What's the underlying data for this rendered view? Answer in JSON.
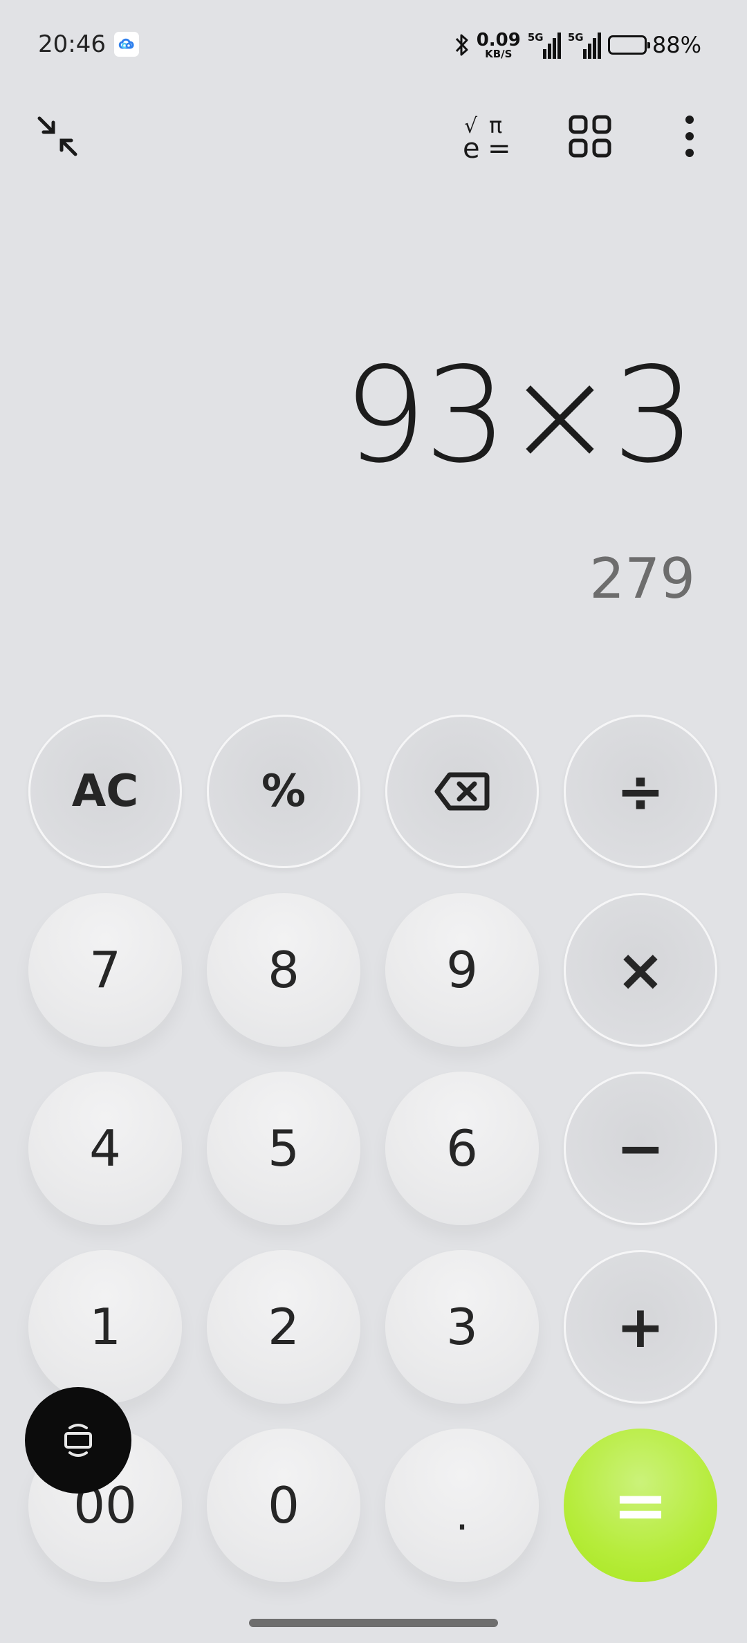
{
  "status_bar": {
    "time": "20:46",
    "app_icon": "cloud-sync-icon",
    "bluetooth_icon": "bluetooth-icon",
    "net_speed_value": "0.09",
    "net_speed_unit": "KB/S",
    "signal_1_label": "5G",
    "signal_2_label": "5G",
    "battery_level": 0.88,
    "battery_text": "88%"
  },
  "toolbar": {
    "minimize_icon": "minimize-arrows-icon",
    "scientific_icon": "scientific-mode-icon",
    "scientific_glyphs": {
      "sqrt": "√",
      "pi": "π",
      "e": "e",
      "eq": "="
    },
    "converter_icon": "grid-converter-icon",
    "more_icon": "more-vertical-icon"
  },
  "display": {
    "expression": "93×3",
    "result": "279"
  },
  "keypad": {
    "row1": [
      "AC",
      "%",
      "backspace",
      "÷"
    ],
    "row2": [
      "7",
      "8",
      "9",
      "×"
    ],
    "row3": [
      "4",
      "5",
      "6",
      "−"
    ],
    "row4": [
      "1",
      "2",
      "3",
      "+"
    ],
    "row5": [
      "00",
      "0",
      ".",
      "="
    ],
    "labels": {
      "ac": "AC",
      "percent": "%",
      "divide": "÷",
      "k7": "7",
      "k8": "8",
      "k9": "9",
      "multiply": "×",
      "k4": "4",
      "k5": "5",
      "k6": "6",
      "minus": "−",
      "k1": "1",
      "k2": "2",
      "k3": "3",
      "plus": "+",
      "k00": "00",
      "k0": "0",
      "dot": ".",
      "equals": "="
    }
  },
  "colors": {
    "background": "#e1e2e5",
    "equals_accent": "#b6ec3a",
    "result_text": "#6d6d6d",
    "floating_button": "#0c0c0c"
  },
  "floating_button": {
    "icon": "screen-rotate-icon"
  }
}
